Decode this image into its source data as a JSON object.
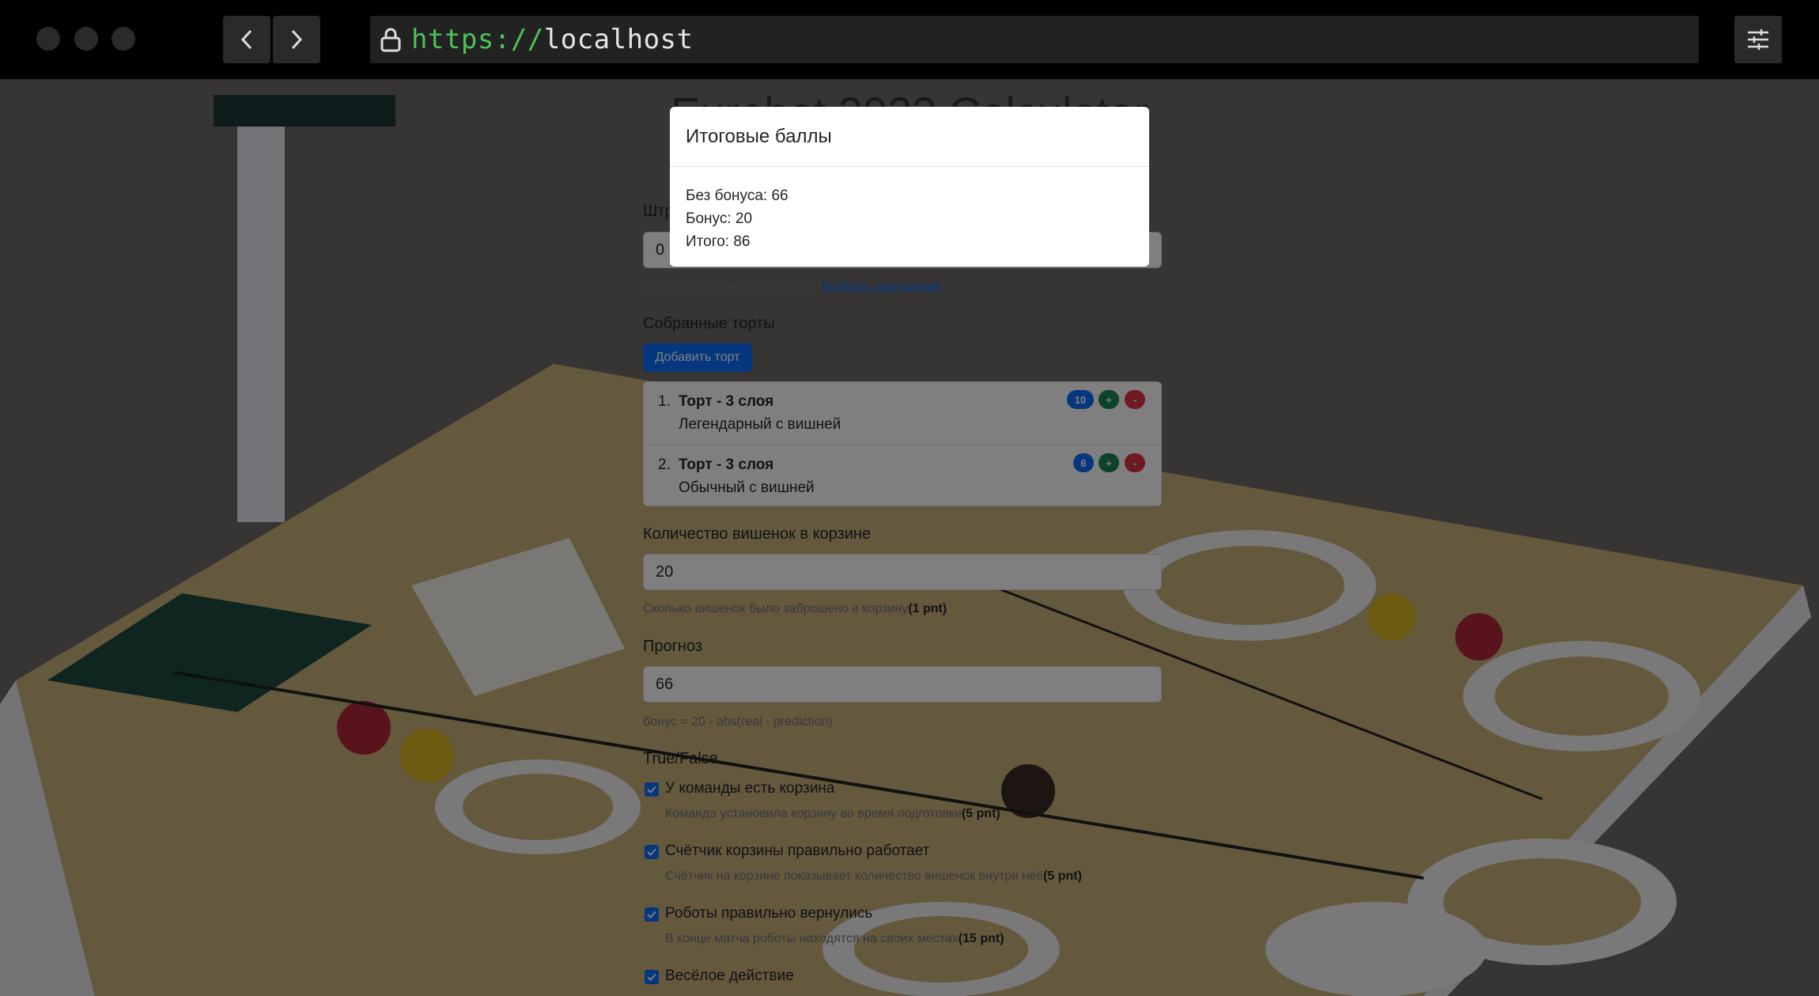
{
  "browser": {
    "url_scheme": "https://",
    "url_host": "localhost"
  },
  "page": {
    "title": "Eurobot 2023 Calculator",
    "penalty": {
      "label": "Штр",
      "value": "0",
      "help_prefix": "Количество штрафных очков (",
      "help_link": "Выбрать нарушения",
      "help_suffix": ")"
    },
    "cakes": {
      "label": "Собранные торты",
      "add_button": "Добавить торт",
      "items": [
        {
          "num": "1.",
          "name": "Торт - 3 слоя",
          "desc": "Легендарный с вишней",
          "score": "10",
          "plus": "+",
          "minus": "-"
        },
        {
          "num": "2.",
          "name": "Торт - 3 слоя",
          "desc": "Обычный с вишней",
          "score": "6",
          "plus": "+",
          "minus": "-"
        }
      ]
    },
    "cherries": {
      "label": "Количество вишенок в корзине",
      "value": "20",
      "help": "Сколько вишенок было заброшено в корзину",
      "help_pts": "(1 pnt)"
    },
    "forecast": {
      "label": "Прогноз",
      "value": "66",
      "help": "бонус = 20 - abs(real - prediction)"
    },
    "truefalse": {
      "label": "True/False",
      "items": [
        {
          "label": "У команды есть корзина",
          "help": "Команда установила корзину во время подготовки",
          "pts": "(5 pnt)",
          "checked": true
        },
        {
          "label": "Счётчик корзины правильно работает",
          "help": "Счётчик на корзине показывает количество вишенок внутри неё",
          "pts": "(5 pnt)",
          "checked": true
        },
        {
          "label": "Роботы правильно вернулись",
          "help": "В конце матча роботы находятся на своих местах",
          "pts": "(15 pnt)",
          "checked": true
        },
        {
          "label": "Весёлое действие",
          "checked": true
        }
      ]
    }
  },
  "modal": {
    "title": "Итоговые баллы",
    "lines": [
      "Без бонуса: 66",
      "Бонус: 20",
      "Итого: 86"
    ]
  },
  "colors": {
    "primary": "#0d6efd",
    "success": "#198754",
    "danger": "#dc3545",
    "url_scheme": "#4cc256"
  }
}
